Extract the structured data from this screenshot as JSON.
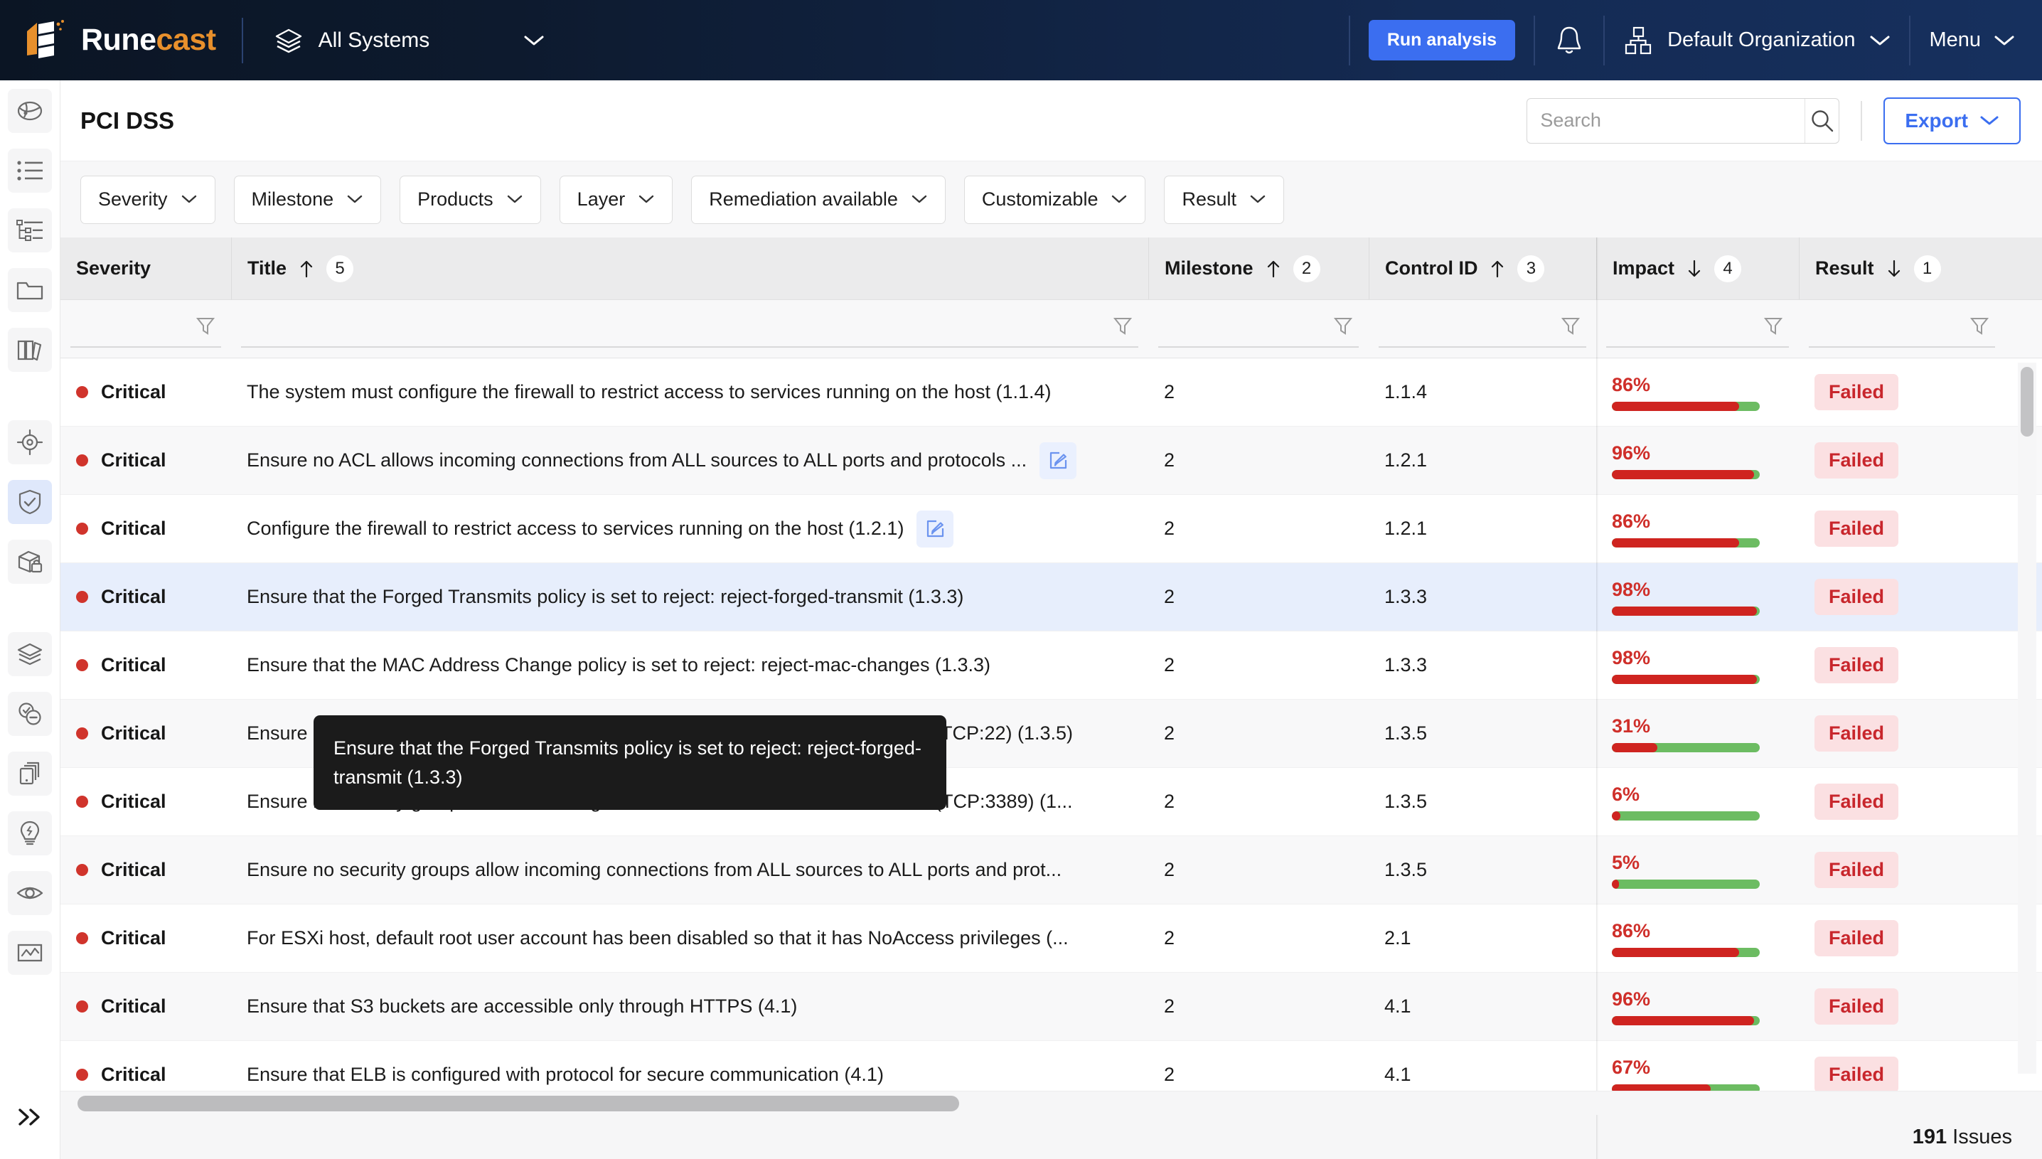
{
  "topbar": {
    "brand_first": "Rune",
    "brand_second": "cast",
    "system_selector": "All Systems",
    "run_analysis_label": "Run analysis",
    "organization": "Default Organization",
    "menu_label": "Menu",
    "accent_blue": "#3b6ef0",
    "accent_orange": "#e8902c"
  },
  "sidebar": {
    "items": [
      {
        "name": "discovery-icon"
      },
      {
        "name": "list-icon"
      },
      {
        "name": "hierarchy-icon"
      },
      {
        "name": "folder-icon"
      },
      {
        "name": "books-icon"
      },
      {
        "name": "target-icon"
      },
      {
        "name": "shield-check-icon",
        "active": true
      },
      {
        "name": "box-lock-icon"
      },
      {
        "name": "layers-icon"
      },
      {
        "name": "check-minus-icon"
      },
      {
        "name": "copy-stack-icon"
      },
      {
        "name": "lightbulb-icon"
      },
      {
        "name": "eye-icon"
      },
      {
        "name": "chart-icon"
      }
    ],
    "expand_label": "expand-sidebar"
  },
  "header": {
    "title": "PCI DSS",
    "search_placeholder": "Search",
    "search_value": "",
    "export_label": "Export"
  },
  "filters": [
    {
      "label": "Severity"
    },
    {
      "label": "Milestone"
    },
    {
      "label": "Products"
    },
    {
      "label": "Layer"
    },
    {
      "label": "Remediation available"
    },
    {
      "label": "Customizable"
    },
    {
      "label": "Result"
    }
  ],
  "table": {
    "columns": [
      {
        "label": "Severity",
        "sort": "",
        "order": ""
      },
      {
        "label": "Title",
        "sort": "up",
        "order": "5"
      },
      {
        "label": "Milestone",
        "sort": "up",
        "order": "2"
      },
      {
        "label": "Control ID",
        "sort": "up",
        "order": "3"
      },
      {
        "label": "Impact",
        "sort": "down",
        "order": "4"
      },
      {
        "label": "Result",
        "sort": "down",
        "order": "1"
      }
    ],
    "rows": [
      {
        "severity": "Critical",
        "title": "The system must configure the firewall to restrict access to services running on the host (1.1.4)",
        "editable": false,
        "milestone": "2",
        "control_id": "1.1.4",
        "impact": "86%",
        "impact_value": 86,
        "result": "Failed",
        "selected": false
      },
      {
        "severity": "Critical",
        "title": "Ensure no ACL allows incoming connections from ALL sources to ALL ports and protocols ...",
        "editable": true,
        "milestone": "2",
        "control_id": "1.2.1",
        "impact": "96%",
        "impact_value": 96,
        "result": "Failed",
        "selected": false
      },
      {
        "severity": "Critical",
        "title": "Configure the firewall to restrict access to services running on the host (1.2.1)",
        "editable": true,
        "milestone": "2",
        "control_id": "1.2.1",
        "impact": "86%",
        "impact_value": 86,
        "result": "Failed",
        "selected": false
      },
      {
        "severity": "Critical",
        "title": "Ensure that the Forged Transmits policy is set to reject: reject-forged-transmit (1.3.3)",
        "editable": false,
        "milestone": "2",
        "control_id": "1.3.3",
        "impact": "98%",
        "impact_value": 98,
        "result": "Failed",
        "selected": true
      },
      {
        "severity": "Critical",
        "title": "Ensure that the MAC Address Change policy is set to reject: reject-mac-changes (1.3.3)",
        "editable": false,
        "milestone": "2",
        "control_id": "1.3.3",
        "impact": "98%",
        "impact_value": 98,
        "result": "Failed",
        "selected": false
      },
      {
        "severity": "Critical",
        "title": "Ensure no security groups allow incoming connections from ALL sources to SSH (TCP:22) (1.3.5)",
        "editable": false,
        "milestone": "2",
        "control_id": "1.3.5",
        "impact": "31%",
        "impact_value": 31,
        "result": "Failed",
        "selected": false
      },
      {
        "severity": "Critical",
        "title": "Ensure no security groups allow incoming connections from ALL sources to RDP (TCP:3389) (1...",
        "editable": false,
        "milestone": "2",
        "control_id": "1.3.5",
        "impact": "6%",
        "impact_value": 6,
        "result": "Failed",
        "selected": false
      },
      {
        "severity": "Critical",
        "title": "Ensure no security groups allow incoming connections from ALL sources to ALL ports and prot...",
        "editable": false,
        "milestone": "2",
        "control_id": "1.3.5",
        "impact": "5%",
        "impact_value": 5,
        "result": "Failed",
        "selected": false
      },
      {
        "severity": "Critical",
        "title": "For ESXi host, default root user account has been disabled so that it has NoAccess privileges (...",
        "editable": false,
        "milestone": "2",
        "control_id": "2.1",
        "impact": "86%",
        "impact_value": 86,
        "result": "Failed",
        "selected": false
      },
      {
        "severity": "Critical",
        "title": "Ensure that S3 buckets are accessible only through HTTPS (4.1)",
        "editable": false,
        "milestone": "2",
        "control_id": "4.1",
        "impact": "96%",
        "impact_value": 96,
        "result": "Failed",
        "selected": false
      },
      {
        "severity": "Critical",
        "title": "Ensure that ELB is configured with protocol for secure communication (4.1)",
        "editable": false,
        "milestone": "2",
        "control_id": "4.1",
        "impact": "67%",
        "impact_value": 67,
        "result": "Failed",
        "selected": false
      }
    ]
  },
  "tooltip": {
    "text": "Ensure that the Forged Transmits policy is set to reject: reject-forged-transmit (1.3.3)"
  },
  "status": {
    "count": "191",
    "label": "Issues"
  },
  "colors": {
    "severity_critical": "#d0342c",
    "impact_bar_failed": "#cf2420",
    "impact_bar_pass": "#6cbc62",
    "result_failed_bg": "#fbe0e2",
    "result_failed_fg": "#c8262c",
    "row_selected": "#e7eefc"
  }
}
